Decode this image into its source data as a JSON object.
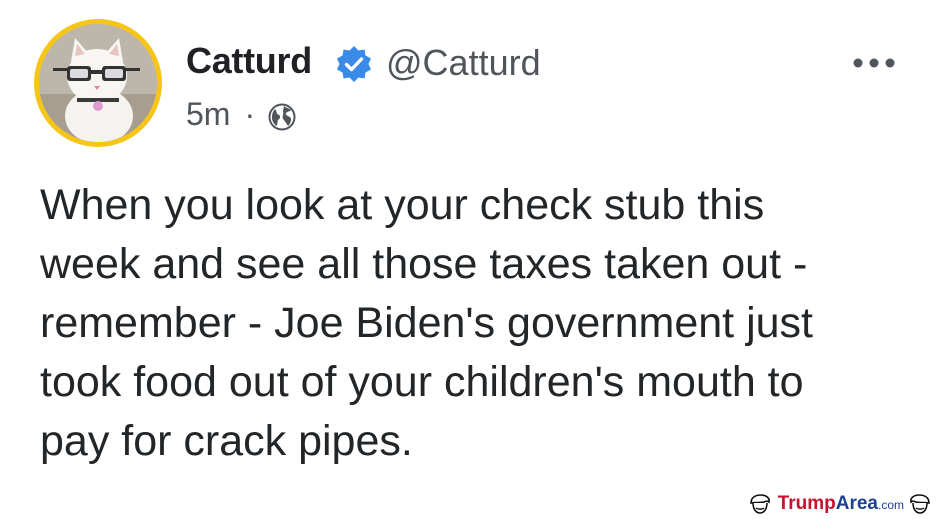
{
  "tweet": {
    "author_name": "Catturd",
    "handle": "@Catturd",
    "timestamp": "5m",
    "separator": "·",
    "visibility_icon": "globe-icon",
    "verified_icon": "verified-badge-icon",
    "more_icon": "more-icon",
    "text": "When you look at your check stub this\nweek and see all those taxes taken out -\nremember - Joe Biden's government just\ntook food out of your children's mouth to\npay for crack pipes."
  },
  "watermark": {
    "brand_part1": "Trump",
    "brand_part2": "Area",
    "brand_part3": ".com"
  },
  "colors": {
    "verified": "#3a8ae8",
    "avatar_ring": "#f5c518",
    "text_primary": "#232629",
    "text_secondary": "#50555b",
    "brand_red": "#c8102e",
    "brand_blue": "#1f3f8f"
  }
}
